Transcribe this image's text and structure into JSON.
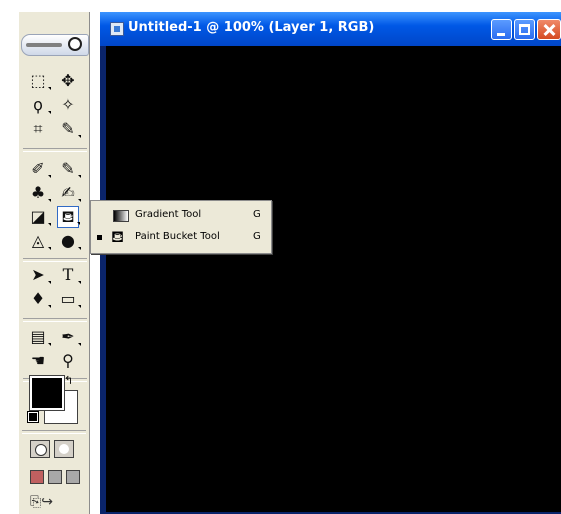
{
  "document": {
    "title": "Untitled-1 @ 100% (Layer 1, RGB)"
  },
  "toolbox": {
    "tools": [
      {
        "row": 1,
        "left": {
          "name": "marquee-icon",
          "glyph": "⬚"
        },
        "right": {
          "name": "move-icon",
          "glyph": "➜"
        }
      },
      {
        "row": 2,
        "left": {
          "name": "lasso-icon",
          "glyph": "ϙ"
        },
        "right": {
          "name": "magic-wand-icon",
          "glyph": "✧"
        }
      },
      {
        "row": 3,
        "left": {
          "name": "crop-icon",
          "glyph": "⌗"
        },
        "right": {
          "name": "slice-icon",
          "glyph": "✎"
        }
      },
      {
        "row": 4,
        "left": {
          "name": "healing-brush-icon",
          "glyph": "✐"
        },
        "right": {
          "name": "brush-icon",
          "glyph": "✎"
        }
      },
      {
        "row": 5,
        "left": {
          "name": "clone-stamp-icon",
          "glyph": "♣"
        },
        "right": {
          "name": "history-brush-icon",
          "glyph": "✍"
        }
      },
      {
        "row": 6,
        "left": {
          "name": "eraser-icon",
          "glyph": "◪"
        },
        "right": {
          "name": "paint-bucket-icon",
          "glyph": "⛾"
        }
      },
      {
        "row": 7,
        "left": {
          "name": "blur-icon",
          "glyph": "◬"
        },
        "right": {
          "name": "dodge-icon",
          "glyph": "●"
        }
      },
      {
        "row": 8,
        "left": {
          "name": "path-selection-icon",
          "glyph": "➤"
        },
        "right": {
          "name": "type-icon",
          "glyph": "T"
        }
      },
      {
        "row": 9,
        "left": {
          "name": "pen-icon",
          "glyph": "♦"
        },
        "right": {
          "name": "shape-icon",
          "glyph": "▭"
        }
      },
      {
        "row": 10,
        "left": {
          "name": "notes-icon",
          "glyph": "▤"
        },
        "right": {
          "name": "eyedropper-icon",
          "glyph": "✒"
        }
      },
      {
        "row": 11,
        "left": {
          "name": "hand-icon",
          "glyph": "☚"
        },
        "right": {
          "name": "zoom-icon",
          "glyph": "⚲"
        }
      }
    ],
    "colors": {
      "foreground": "#000000",
      "background": "#ffffff"
    }
  },
  "flyout": {
    "items": [
      {
        "label": "Gradient Tool",
        "shortcut": "G",
        "selected": false
      },
      {
        "label": "Paint Bucket Tool",
        "shortcut": "G",
        "selected": true
      }
    ]
  }
}
